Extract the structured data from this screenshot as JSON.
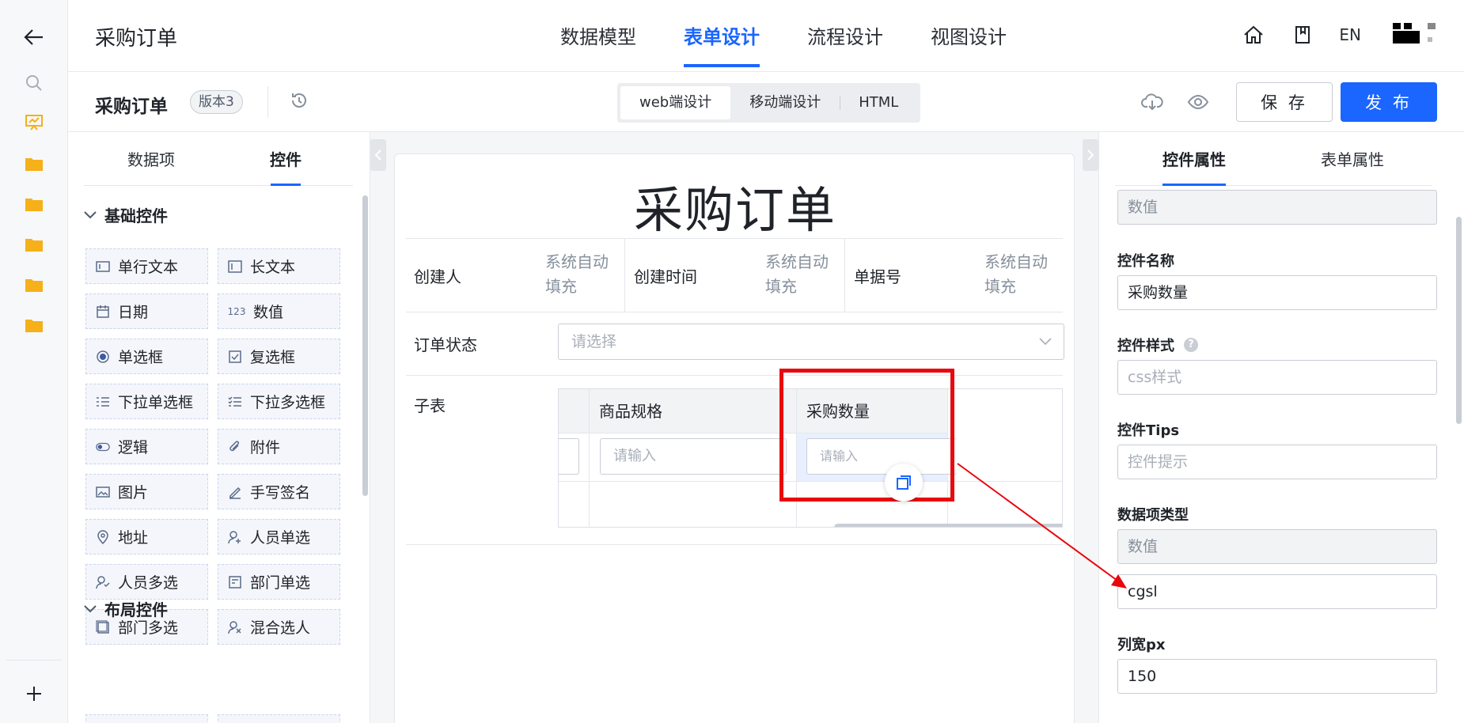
{
  "rail": {
    "icons": [
      "back-arrow-icon",
      "search-icon",
      "presentation-icon",
      "folder-icon",
      "folder-icon",
      "folder-icon",
      "folder-icon",
      "folder-icon",
      "plus-icon"
    ],
    "accent": "#f5b01a"
  },
  "header": {
    "app_title": "采购订单",
    "tabs": [
      "数据模型",
      "表单设计",
      "流程设计",
      "视图设计"
    ],
    "active_tab": "表单设计",
    "lang": "EN"
  },
  "toolbar": {
    "form_name": "采购订单",
    "version": "版本3",
    "modes": [
      "web端设计",
      "移动端设计",
      "HTML"
    ],
    "active_mode": "web端设计",
    "save_label": "保 存",
    "publish_label": "发 布"
  },
  "left_panel": {
    "tabs": [
      "数据项",
      "控件"
    ],
    "active_tab": "控件",
    "basic_group": "基础控件",
    "controls": [
      {
        "label": "单行文本",
        "icon": "text-line-icon"
      },
      {
        "label": "长文本",
        "icon": "textarea-icon"
      },
      {
        "label": "日期",
        "icon": "calendar-icon"
      },
      {
        "label": "数值",
        "icon": "number-icon"
      },
      {
        "label": "单选框",
        "icon": "radio-icon"
      },
      {
        "label": "复选框",
        "icon": "checkbox-icon"
      },
      {
        "label": "下拉单选框",
        "icon": "dropdown-single-icon"
      },
      {
        "label": "下拉多选框",
        "icon": "dropdown-multi-icon"
      },
      {
        "label": "逻辑",
        "icon": "toggle-icon"
      },
      {
        "label": "附件",
        "icon": "paperclip-icon"
      },
      {
        "label": "图片",
        "icon": "image-icon"
      },
      {
        "label": "手写签名",
        "icon": "pen-icon"
      },
      {
        "label": "地址",
        "icon": "location-icon"
      },
      {
        "label": "人员单选",
        "icon": "user-add-icon"
      },
      {
        "label": "人员多选",
        "icon": "users-icon"
      },
      {
        "label": "部门单选",
        "icon": "department-icon"
      },
      {
        "label": "部门多选",
        "icon": "departments-icon"
      },
      {
        "label": "混合选人",
        "icon": "user-mixed-icon"
      }
    ],
    "layout_group": "布局控件"
  },
  "canvas": {
    "title": "采购订单",
    "row1": [
      {
        "label": "创建人",
        "value": "系统自动\n填充"
      },
      {
        "label": "创建时间",
        "value": "系统自动\n填充"
      },
      {
        "label": "单据号",
        "value": "系统自动\n填充"
      }
    ],
    "status_label": "订单状态",
    "status_placeholder": "请选择",
    "subtable_label": "子表",
    "subtable_columns": [
      "商品规格",
      "采购数量"
    ],
    "input_placeholder": "请输入"
  },
  "right_panel": {
    "tabs": [
      "控件属性",
      "表单属性"
    ],
    "active_tab": "控件属性",
    "top_field": "数值",
    "name_label": "控件名称",
    "name_value": "采购数量",
    "style_label": "控件样式",
    "style_placeholder": "css样式",
    "tips_label": "控件Tips",
    "tips_placeholder": "控件提示",
    "datatype_label": "数据项类型",
    "datatype_value": "数值",
    "code_value": "cgsl",
    "width_label": "列宽px",
    "width_value": "150"
  },
  "colors": {
    "primary": "#1a66ff",
    "highlight_box": "#e8080d"
  }
}
